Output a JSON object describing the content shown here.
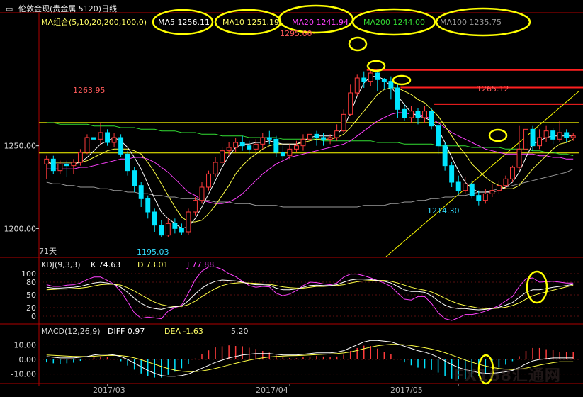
{
  "window": {
    "title": "伦敦金现(贵金属 5120)日线",
    "ma_group_label": "MA组合(5,10,20,200,100,0)"
  },
  "ma_legend": [
    {
      "label": "MA5 1256.11",
      "color": "#ffffff"
    },
    {
      "label": "MA10 1251.19",
      "color": "#ffff66"
    },
    {
      "label": "MA20 1241.94",
      "color": "#ff40ff"
    },
    {
      "label": "MA200 1244.00",
      "color": "#33dd33"
    },
    {
      "label": "MA100 1235.75",
      "color": "#9a9a9a"
    }
  ],
  "price_annotations": {
    "high_marker": "1295.60",
    "left_high": "1263.95",
    "right_high": "1265.12",
    "left_low": "1195.03",
    "right_low": "1214.30",
    "days_label": "71天"
  },
  "kdj": {
    "label": "KDJ(9,3,3)",
    "k": "K  74.63",
    "d": "D  73.01",
    "j": "J  77.88"
  },
  "macd": {
    "label": "MACD(12,26,9)",
    "diff": "DIFF  0.97",
    "dea": "DEA  -1.63",
    "macd": "5.20"
  },
  "x_axis": [
    "2017/03",
    "2017/04",
    "2017/05"
  ],
  "watermark": "FX168汇通网",
  "colors": {
    "up": "#ff3b3b",
    "down": "#00e5ff",
    "ma5": "#ffffff",
    "ma10": "#ffff44",
    "ma20": "#ff40ff",
    "ma200": "#33dd33",
    "ma100": "#9a9a9a",
    "highlight": "#ffff00",
    "axis": "#b00000"
  },
  "chart_data": {
    "type": "candlestick",
    "price_axis": {
      "ticks": [
        1250.0,
        1200.0
      ],
      "ylim": [
        1183,
        1321
      ]
    },
    "kdj_axis": {
      "ticks": [
        100,
        80,
        50,
        20,
        0
      ]
    },
    "macd_axis": {
      "ticks": [
        10.0,
        0.0,
        -10.0
      ]
    },
    "horizontal_levels": [
      1263.95,
      1245.7
    ],
    "candles": [
      [
        1239,
        1242,
        1230,
        1244
      ],
      [
        1242,
        1235,
        1233,
        1244
      ],
      [
        1235,
        1239,
        1233,
        1241
      ],
      [
        1239,
        1238,
        1231,
        1241
      ],
      [
        1238,
        1240,
        1233,
        1242
      ],
      [
        1240,
        1246,
        1238,
        1248
      ],
      [
        1246,
        1255,
        1245,
        1257
      ],
      [
        1255,
        1254,
        1250,
        1261
      ],
      [
        1254,
        1258,
        1251,
        1264
      ],
      [
        1258,
        1252,
        1250,
        1260
      ],
      [
        1252,
        1255,
        1249,
        1258
      ],
      [
        1255,
        1245,
        1243,
        1257
      ],
      [
        1245,
        1235,
        1232,
        1247
      ],
      [
        1235,
        1226,
        1222,
        1237
      ],
      [
        1226,
        1218,
        1213,
        1228
      ],
      [
        1218,
        1210,
        1206,
        1220
      ],
      [
        1210,
        1202,
        1198,
        1212
      ],
      [
        1202,
        1196,
        1195,
        1205
      ],
      [
        1196,
        1203,
        1195,
        1206
      ],
      [
        1203,
        1200,
        1197,
        1206
      ],
      [
        1200,
        1198,
        1196,
        1203
      ],
      [
        1198,
        1210,
        1196,
        1212
      ],
      [
        1210,
        1217,
        1208,
        1219
      ],
      [
        1217,
        1225,
        1215,
        1228
      ],
      [
        1225,
        1233,
        1223,
        1235
      ],
      [
        1233,
        1240,
        1231,
        1243
      ],
      [
        1240,
        1247,
        1238,
        1249
      ],
      [
        1247,
        1249,
        1244,
        1252
      ],
      [
        1249,
        1252,
        1246,
        1255
      ],
      [
        1252,
        1250,
        1247,
        1256
      ],
      [
        1250,
        1248,
        1245,
        1253
      ],
      [
        1248,
        1251,
        1246,
        1254
      ],
      [
        1251,
        1255,
        1248,
        1258
      ],
      [
        1255,
        1254,
        1251,
        1259
      ],
      [
        1254,
        1246,
        1243,
        1256
      ],
      [
        1246,
        1244,
        1241,
        1250
      ],
      [
        1244,
        1248,
        1242,
        1251
      ],
      [
        1248,
        1250,
        1246,
        1253
      ],
      [
        1250,
        1254,
        1247,
        1257
      ],
      [
        1254,
        1257,
        1250,
        1259
      ],
      [
        1257,
        1255,
        1250,
        1259
      ],
      [
        1255,
        1254,
        1250,
        1258
      ],
      [
        1254,
        1255,
        1251,
        1257
      ],
      [
        1255,
        1259,
        1253,
        1263
      ],
      [
        1259,
        1269,
        1258,
        1272
      ],
      [
        1269,
        1282,
        1268,
        1287
      ],
      [
        1282,
        1291,
        1280,
        1293
      ],
      [
        1291,
        1289,
        1285,
        1295
      ],
      [
        1289,
        1294,
        1286,
        1296
      ],
      [
        1294,
        1290,
        1283,
        1296
      ],
      [
        1290,
        1289,
        1284,
        1291
      ],
      [
        1289,
        1285,
        1278,
        1292
      ],
      [
        1285,
        1272,
        1267,
        1287
      ],
      [
        1272,
        1267,
        1265,
        1275
      ],
      [
        1267,
        1271,
        1264,
        1274
      ],
      [
        1271,
        1267,
        1263,
        1273
      ],
      [
        1267,
        1271,
        1264,
        1274
      ],
      [
        1271,
        1262,
        1260,
        1273
      ],
      [
        1262,
        1250,
        1245,
        1265
      ],
      [
        1250,
        1238,
        1235,
        1252
      ],
      [
        1238,
        1228,
        1225,
        1240
      ],
      [
        1228,
        1223,
        1221,
        1232
      ],
      [
        1223,
        1227,
        1221,
        1231
      ],
      [
        1227,
        1220,
        1218,
        1229
      ],
      [
        1220,
        1217,
        1214,
        1223
      ],
      [
        1217,
        1221,
        1215,
        1224
      ],
      [
        1221,
        1223,
        1219,
        1227
      ],
      [
        1223,
        1226,
        1221,
        1229
      ],
      [
        1226,
        1230,
        1224,
        1232
      ],
      [
        1230,
        1237,
        1228,
        1238
      ],
      [
        1237,
        1248,
        1235,
        1262
      ],
      [
        1248,
        1260,
        1246,
        1264
      ],
      [
        1260,
        1250,
        1247,
        1262
      ],
      [
        1250,
        1255,
        1248,
        1260
      ],
      [
        1255,
        1259,
        1252,
        1262
      ],
      [
        1259,
        1254,
        1251,
        1261
      ],
      [
        1254,
        1258,
        1252,
        1265
      ],
      [
        1258,
        1255,
        1252,
        1260
      ],
      [
        1255,
        1256,
        1253,
        1258
      ]
    ],
    "ma5": [
      1240,
      1239,
      1239,
      1239,
      1239,
      1240,
      1243,
      1247,
      1251,
      1253,
      1255,
      1253,
      1249,
      1243,
      1236,
      1227,
      1218,
      1210,
      1206,
      1203,
      1200,
      1201,
      1206,
      1213,
      1221,
      1229,
      1237,
      1244,
      1249,
      1251,
      1251,
      1252,
      1252,
      1253,
      1252,
      1251,
      1251,
      1251,
      1253,
      1255,
      1256,
      1256,
      1256,
      1257,
      1261,
      1270,
      1280,
      1288,
      1292,
      1292,
      1290,
      1286,
      1280,
      1275,
      1270,
      1268,
      1267,
      1265,
      1260,
      1252,
      1243,
      1235,
      1228,
      1224,
      1222,
      1222,
      1222,
      1223,
      1225,
      1228,
      1234,
      1243,
      1251,
      1253,
      1255,
      1256,
      1256,
      1256,
      1256
    ],
    "ma10": [
      1240,
      1240,
      1240,
      1240,
      1240,
      1240,
      1241,
      1243,
      1245,
      1247,
      1248,
      1248,
      1248,
      1247,
      1245,
      1240,
      1234,
      1227,
      1220,
      1213,
      1207,
      1204,
      1204,
      1205,
      1209,
      1214,
      1220,
      1226,
      1233,
      1238,
      1242,
      1245,
      1248,
      1250,
      1251,
      1251,
      1251,
      1251,
      1252,
      1253,
      1254,
      1254,
      1254,
      1255,
      1257,
      1261,
      1266,
      1271,
      1276,
      1281,
      1284,
      1285,
      1285,
      1283,
      1281,
      1278,
      1276,
      1272,
      1268,
      1262,
      1256,
      1250,
      1245,
      1239,
      1235,
      1231,
      1228,
      1226,
      1224,
      1224,
      1226,
      1231,
      1236,
      1240,
      1244,
      1248,
      1251,
      1252,
      1254
    ],
    "ma20": [
      1236,
      1236,
      1236,
      1236,
      1236,
      1237,
      1237,
      1238,
      1239,
      1240,
      1241,
      1242,
      1242,
      1243,
      1243,
      1242,
      1240,
      1237,
      1234,
      1230,
      1226,
      1222,
      1220,
      1217,
      1216,
      1215,
      1215,
      1216,
      1218,
      1221,
      1225,
      1229,
      1233,
      1236,
      1239,
      1241,
      1243,
      1244,
      1245,
      1246,
      1247,
      1248,
      1249,
      1250,
      1251,
      1253,
      1256,
      1259,
      1262,
      1265,
      1267,
      1269,
      1270,
      1270,
      1269,
      1269,
      1268,
      1266,
      1264,
      1261,
      1258,
      1256,
      1254,
      1252,
      1250,
      1248,
      1247,
      1246,
      1245,
      1245,
      1245,
      1245,
      1245,
      1244,
      1244,
      1243,
      1243,
      1242,
      1242
    ],
    "ma200": [
      1264,
      1264,
      1263,
      1263,
      1263,
      1263,
      1263,
      1262,
      1262,
      1262,
      1262,
      1261,
      1261,
      1261,
      1260,
      1260,
      1260,
      1259,
      1259,
      1259,
      1258,
      1258,
      1258,
      1257,
      1257,
      1257,
      1256,
      1256,
      1256,
      1256,
      1255,
      1255,
      1255,
      1255,
      1255,
      1254,
      1254,
      1254,
      1254,
      1254,
      1254,
      1253,
      1253,
      1253,
      1253,
      1253,
      1253,
      1253,
      1253,
      1252,
      1252,
      1252,
      1252,
      1251,
      1251,
      1251,
      1251,
      1251,
      1250,
      1250,
      1250,
      1250,
      1250,
      1249,
      1249,
      1249,
      1249,
      1249,
      1248,
      1248,
      1248,
      1248,
      1247,
      1247,
      1246,
      1246,
      1245,
      1245,
      1244
    ],
    "ma100": [
      1228,
      1227,
      1227,
      1226,
      1226,
      1225,
      1225,
      1225,
      1224,
      1224,
      1223,
      1223,
      1222,
      1222,
      1221,
      1221,
      1220,
      1220,
      1219,
      1219,
      1218,
      1218,
      1218,
      1217,
      1217,
      1216,
      1216,
      1216,
      1215,
      1215,
      1215,
      1214,
      1214,
      1214,
      1214,
      1213,
      1213,
      1213,
      1213,
      1213,
      1213,
      1213,
      1213,
      1213,
      1213,
      1213,
      1213,
      1214,
      1214,
      1214,
      1214,
      1215,
      1215,
      1216,
      1216,
      1217,
      1217,
      1218,
      1218,
      1219,
      1219,
      1220,
      1220,
      1221,
      1222,
      1222,
      1223,
      1224,
      1225,
      1226,
      1227,
      1228,
      1229,
      1230,
      1231,
      1232,
      1233,
      1234,
      1236
    ],
    "kdj_k": [
      68,
      66,
      66,
      67,
      68,
      70,
      74,
      78,
      80,
      78,
      75,
      68,
      56,
      42,
      30,
      22,
      18,
      16,
      20,
      22,
      24,
      36,
      52,
      66,
      76,
      82,
      85,
      84,
      83,
      80,
      76,
      74,
      74,
      73,
      66,
      62,
      62,
      64,
      68,
      72,
      73,
      72,
      72,
      74,
      80,
      85,
      87,
      87,
      86,
      84,
      82,
      78,
      70,
      62,
      58,
      58,
      56,
      48,
      36,
      26,
      20,
      18,
      18,
      16,
      15,
      16,
      18,
      21,
      26,
      32,
      44,
      56,
      62,
      62,
      65,
      68,
      70,
      72,
      75
    ],
    "kdj_d": [
      62,
      63,
      64,
      64,
      65,
      66,
      68,
      71,
      74,
      75,
      75,
      73,
      67,
      59,
      50,
      41,
      33,
      27,
      24,
      23,
      23,
      27,
      35,
      46,
      56,
      65,
      72,
      76,
      78,
      79,
      78,
      77,
      76,
      75,
      72,
      69,
      67,
      66,
      66,
      68,
      70,
      70,
      71,
      72,
      74,
      78,
      81,
      83,
      84,
      84,
      84,
      82,
      78,
      73,
      68,
      64,
      61,
      57,
      50,
      42,
      35,
      29,
      25,
      22,
      19,
      18,
      18,
      19,
      21,
      25,
      31,
      40,
      48,
      53,
      57,
      61,
      65,
      69,
      73
    ],
    "kdj_j": [
      74,
      70,
      70,
      73,
      74,
      78,
      86,
      92,
      92,
      84,
      75,
      58,
      34,
      8,
      -5,
      -2,
      -4,
      -6,
      12,
      20,
      26,
      54,
      86,
      106,
      116,
      116,
      110,
      100,
      93,
      82,
      72,
      68,
      70,
      69,
      54,
      48,
      52,
      60,
      72,
      80,
      79,
      76,
      74,
      78,
      92,
      99,
      99,
      95,
      90,
      84,
      78,
      70,
      54,
      40,
      38,
      46,
      46,
      30,
      8,
      -6,
      -10,
      -4,
      4,
      4,
      7,
      12,
      18,
      25,
      36,
      46,
      70,
      88,
      90,
      80,
      81,
      82,
      80,
      78,
      78
    ],
    "macd_diff": [
      2,
      1.5,
      1,
      1,
      1,
      1.5,
      2,
      3,
      3.5,
      3.5,
      3,
      2,
      0,
      -2.5,
      -5,
      -7.5,
      -9.5,
      -11,
      -11.5,
      -11.5,
      -11,
      -10,
      -8,
      -6,
      -4,
      -2,
      -0.5,
      1,
      2,
      3,
      3.5,
      4,
      4,
      4,
      3.5,
      3,
      3,
      3,
      3.5,
      4,
      4.5,
      4.5,
      4.5,
      5,
      6,
      8,
      10,
      12,
      13,
      13,
      12.5,
      12,
      10.5,
      9,
      7.5,
      6,
      5,
      3.5,
      1.5,
      -1,
      -3.5,
      -5.5,
      -7,
      -8,
      -9,
      -9.5,
      -9.5,
      -9,
      -8.5,
      -7.5,
      -5.5,
      -3,
      -1,
      0,
      0.5,
      1,
      1,
      1,
      1
    ],
    "macd_dea": [
      3,
      2.8,
      2.5,
      2.3,
      2.1,
      2,
      2,
      2.2,
      2.5,
      2.7,
      2.8,
      2.6,
      2.1,
      1,
      -0.2,
      -1.7,
      -3.3,
      -4.8,
      -6.2,
      -7.3,
      -8,
      -8.4,
      -8.3,
      -7.9,
      -7.1,
      -6.1,
      -5,
      -3.8,
      -2.6,
      -1.5,
      -0.5,
      0.4,
      1.1,
      1.7,
      2.1,
      2.3,
      2.5,
      2.6,
      2.8,
      3,
      3.3,
      3.5,
      3.7,
      4,
      4.4,
      5.1,
      6.1,
      7.3,
      8.4,
      9.3,
      9.9,
      10.3,
      10.3,
      10,
      9.5,
      8.8,
      8,
      7.1,
      6,
      4.6,
      3,
      1.3,
      -0.4,
      -1.9,
      -3.3,
      -4.5,
      -5.5,
      -6.2,
      -6.7,
      -6.9,
      -6.6,
      -5.9,
      -4.9,
      -3.9,
      -3,
      -2.2,
      -1.6,
      -1.6,
      -1.6
    ],
    "macd_hist": [
      -2,
      -2.6,
      -3,
      -2.6,
      -2.2,
      -1,
      0,
      1.6,
      2,
      1.6,
      0.4,
      -1.2,
      -4.2,
      -7,
      -9.6,
      -11.6,
      -12.4,
      -12.4,
      -10.6,
      -8.4,
      -6,
      -3.2,
      0.6,
      3.8,
      6.2,
      8.2,
      9,
      9.6,
      9.2,
      9,
      8,
      7.2,
      5.8,
      4.6,
      2.8,
      1.4,
      1,
      0.8,
      1.4,
      2,
      2.4,
      2,
      1.6,
      2,
      3.2,
      5.8,
      7.8,
      9.4,
      9.2,
      7.4,
      5.2,
      3.4,
      0.4,
      -2,
      -4,
      -5.6,
      -6,
      -7.2,
      -9,
      -11.2,
      -13,
      -13.6,
      -13.2,
      -12.2,
      -11.4,
      -10,
      -8,
      -5.6,
      -3.6,
      -1.2,
      2.2,
      5.8,
      7.8,
      7.8,
      7,
      6.4,
      5.2,
      5.2,
      5.2
    ]
  }
}
